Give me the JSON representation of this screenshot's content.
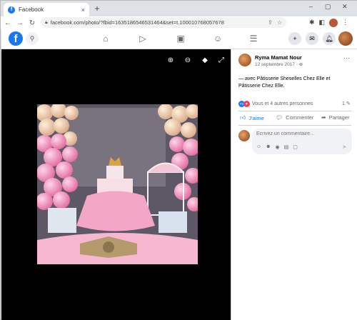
{
  "browser": {
    "tab_title": "Facebook",
    "tab_close": "×",
    "new_tab": "+",
    "url": "facebook.com/photo/?fbid=1635186546531464&set=t.100010768057678",
    "win_min": "–",
    "win_max": "▢",
    "win_close": "✕"
  },
  "fbnav": {
    "logo": "f"
  },
  "post": {
    "author": "Ryma Mamat Nour",
    "date": "12 septembre 2017 · ⊕",
    "caption": "— avec Pâtisserie Sheselles Chez Elle et Pâtisserie Chez Elle.",
    "reactions_text": "Vous et 4 autres personnes",
    "comment_count": "1",
    "like_label": "J'aime",
    "comment_label": "Commenter",
    "share_label": "Partager",
    "comment_placeholder": "Écrivez un commentaire…"
  },
  "colors": {
    "fb_blue": "#1877f2",
    "viewer_bg": "#000000"
  }
}
